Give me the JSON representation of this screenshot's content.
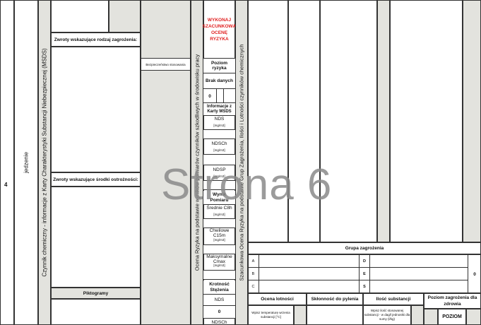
{
  "row_number": "4",
  "unit": "jedzenie",
  "left_vertical": "Czynnik chemiczny - informacje z Karty Charakterystyki Substancji Niebezpiecznej (MSDS)",
  "hazard_phrases_label": "Zwroty wskazujące rodzaj zagrożenia:",
  "precaution_label": "Zwroty wskazujące środki ostrożności:",
  "pictograms_label": "Piktogramy",
  "storage_label": "Bezpieczeństwo stosowania",
  "assessment_vertical": "Ocena Ryzyka na podstawie wyników pomiarów czynników szkodliwych w środowisku pracy",
  "action_note": "WYKONAJ SZACUNKOWĄ OCENĘ RYZYKA",
  "risk_level_label": "Poziom ryzyka",
  "no_data": "Brak danych",
  "zero": "0",
  "msds_info": "Informacje z Karty MSDS",
  "nds": "NDS",
  "ndsch": "NDSCh",
  "ndsp": "NDSP",
  "unit_mgm3": "[mg/m3]",
  "measurement_result": "Wynik Pomiaru",
  "avg_c8h": "Średnie C8h",
  "inst_c15m": "Chwilowe C15m",
  "max_cmax": "Maksymalne Cmax",
  "multiplicity": "Krotność Stężenia",
  "nds2": "NDS",
  "zero2": "0",
  "ndsch2": "NDSCh",
  "estimate_vertical": "Szacunkowa Ocena Ryzyka na podstawie Grup Zagrożenia, Ilości i Lotności czynników chemicznych",
  "watermark": "Strona 6",
  "hazard_group_header": "Grupa zagrożenia",
  "groups_left": [
    "A",
    "B",
    "C"
  ],
  "groups_right": [
    "D",
    "E",
    "S"
  ],
  "group_result": "0",
  "volatility_label": "Ocena lotności",
  "volatility_sub": "Wpisz temperaturę wrzenia substancji [°C]",
  "dust_label": "Skłonność do pylenia",
  "quantity_label": "Ilość substancji",
  "quantity_sub": "Wpisz ilość stosowanej substancji - w dag/l jednostki dla sumy (l/kg)",
  "hazard_level_label": "Poziom zagrożenia dla zdrowia",
  "level_label": "POZIOM"
}
